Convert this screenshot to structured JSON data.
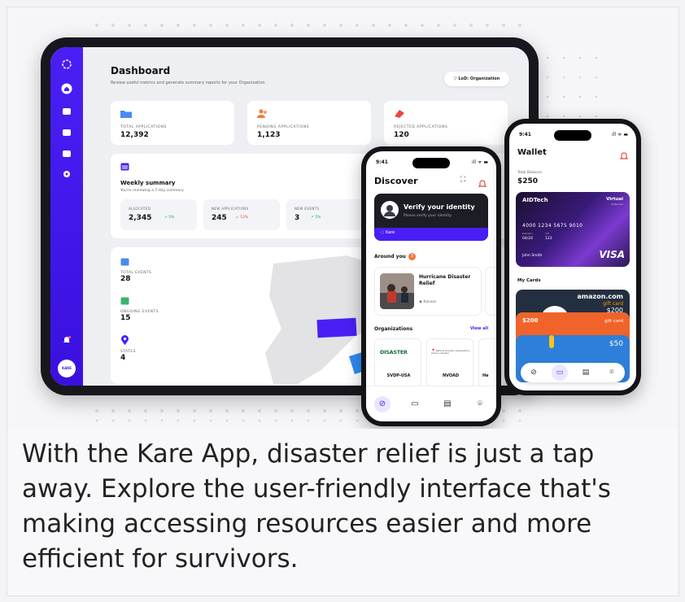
{
  "caption": "With the Kare App, disaster relief is just a tap away. Explore the user-friendly interface that's making accessing resources easier and more efficient for survivors.",
  "colors": {
    "brand": "#4a1ff5",
    "positive": "#22a45d",
    "negative": "#e5483a"
  },
  "dashboard": {
    "title": "Dashboard",
    "subtitle": "Review useful metrics and generate summary reports for your Organization",
    "lod_button": "LoD: Organization",
    "sidebar_icons": [
      "logo-icon",
      "home-icon",
      "folder-icon",
      "calendar-icon",
      "inbox-icon",
      "settings-icon",
      "bell-icon",
      "avatar-icon"
    ],
    "avatar_text": "KARE",
    "stats": [
      {
        "label": "TOTAL APPLICATIONS",
        "value": "12,392",
        "icon": "folder-icon"
      },
      {
        "label": "PENDING APPLICATIONS",
        "value": "1,123",
        "icon": "users-icon"
      },
      {
        "label": "REJECTED APPLICATIONS",
        "value": "120",
        "icon": "reject-icon"
      }
    ],
    "weekly": {
      "title": "Weekly summary",
      "subtitle": "You're reviewing a 7-day summary",
      "items": [
        {
          "label": "ALLOCATED",
          "value": "2,345",
          "delta": "↗ 5%",
          "trend": "up"
        },
        {
          "label": "NEW APPLICATIONS",
          "value": "245",
          "delta": "↙ 12%",
          "trend": "down"
        },
        {
          "label": "NEW EVENTS",
          "value": "3",
          "delta": "↗ 5%",
          "trend": "up"
        }
      ]
    },
    "events": [
      {
        "label": "TOTAL EVENTS",
        "value": "28",
        "icon": "calendar-icon"
      },
      {
        "label": "ONGOING EVENTS",
        "value": "15",
        "icon": "calendar-check-icon"
      },
      {
        "label": "STATES",
        "value": "4",
        "icon": "map-pin-icon"
      }
    ]
  },
  "discover": {
    "time": "9:41",
    "signal": "ıll ᯤ ▬",
    "title": "Discover",
    "verify_title": "Verify your identity",
    "verify_sub": "Please verify your identity",
    "kare_tag": "Kare",
    "around_label": "Around you",
    "around_count": "3",
    "event_title": "Hurricane Disaster Relief",
    "event_location": "Kansas",
    "orgs_label": "Organizations",
    "view_all": "View all",
    "orgs": [
      {
        "name": "SVDP-USA",
        "logo": "DISASTER"
      },
      {
        "name": "NVOAD",
        "logo": "National Voluntary Organizations Active in Disaster"
      },
      {
        "name": "He"
      }
    ]
  },
  "wallet": {
    "time": "9:41",
    "signal": "ıll ᯤ ▬",
    "title": "Wallet",
    "balance_label": "Total Balance",
    "balance": "$250",
    "card": {
      "brand": "AIDTech",
      "tier": "Virtual",
      "tier_sub": "Limited Use",
      "number": "4000 1234 5675 9010",
      "expiry_label": "Expiration",
      "expiry": "04/24",
      "cvv_label": "CVV",
      "cvv": "123",
      "holder": "John Smith",
      "network": "VISA"
    },
    "my_cards": "My Cards",
    "gift_cards": [
      {
        "brand": "amazon.com",
        "kind": "gift card",
        "amount": "$200"
      },
      {
        "amount": "$200",
        "kind": "gift card"
      },
      {
        "amount": "$50"
      }
    ]
  }
}
